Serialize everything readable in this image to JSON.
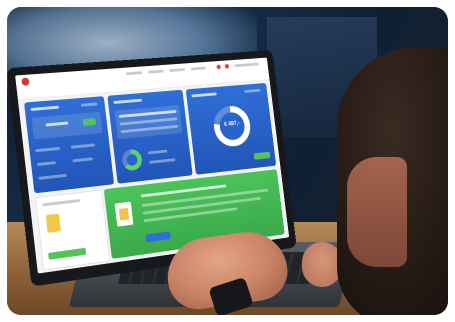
{
  "photo": {
    "subject": "",
    "screen_value": "€ 487,-"
  },
  "colors": {
    "card_blue": "#2f6fd6",
    "banner_green": "#4cc35a",
    "table_wood": "#a5794b"
  }
}
